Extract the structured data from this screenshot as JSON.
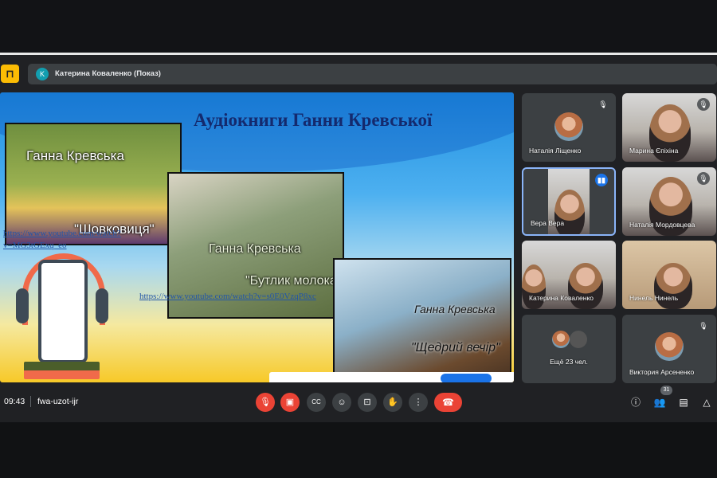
{
  "header": {
    "presenter_initial": "K",
    "presenter_label": "Катерина Коваленко (Показ)",
    "door_icon": "door-icon"
  },
  "slide": {
    "title": "Аудіокниги Ганни Кревської",
    "books": [
      {
        "author": "Ганна Кревська",
        "title": "\"Шовковиця\"",
        "link": "https://www.youtube.com/watch?v=MG3tGExq_eo"
      },
      {
        "author": "Ганна Кревська",
        "title": "\"Бутлик молока",
        "link": "https://www.youtube.com/watch?v=s0E0VzqP8xc"
      },
      {
        "author": "Ганна Кревська",
        "title": "\"Щедрий вечір\""
      }
    ]
  },
  "participants": [
    {
      "name": "Наталія Ліщенко",
      "muted": true,
      "video": false
    },
    {
      "name": "Марина Єпіхіна",
      "muted": true,
      "video": true
    },
    {
      "name": "Вера Вера",
      "speaking": true,
      "video": true
    },
    {
      "name": "Наталія Мордовцева",
      "muted": true,
      "video": true
    },
    {
      "name": "Катерина Коваленко",
      "video": true
    },
    {
      "name": "Нинель Нинель",
      "video": true
    },
    {
      "name": "Ещё 23 чел."
    },
    {
      "name": "Виктория Арсененко",
      "muted": true,
      "video": false
    }
  ],
  "footer": {
    "time": "09:43",
    "meeting_code": "fwa-uzot-ijr",
    "participant_count": "31"
  },
  "colors": {
    "accent": "#1a73e8",
    "danger": "#ea4335",
    "surface": "#3c4043",
    "background": "#202124"
  }
}
